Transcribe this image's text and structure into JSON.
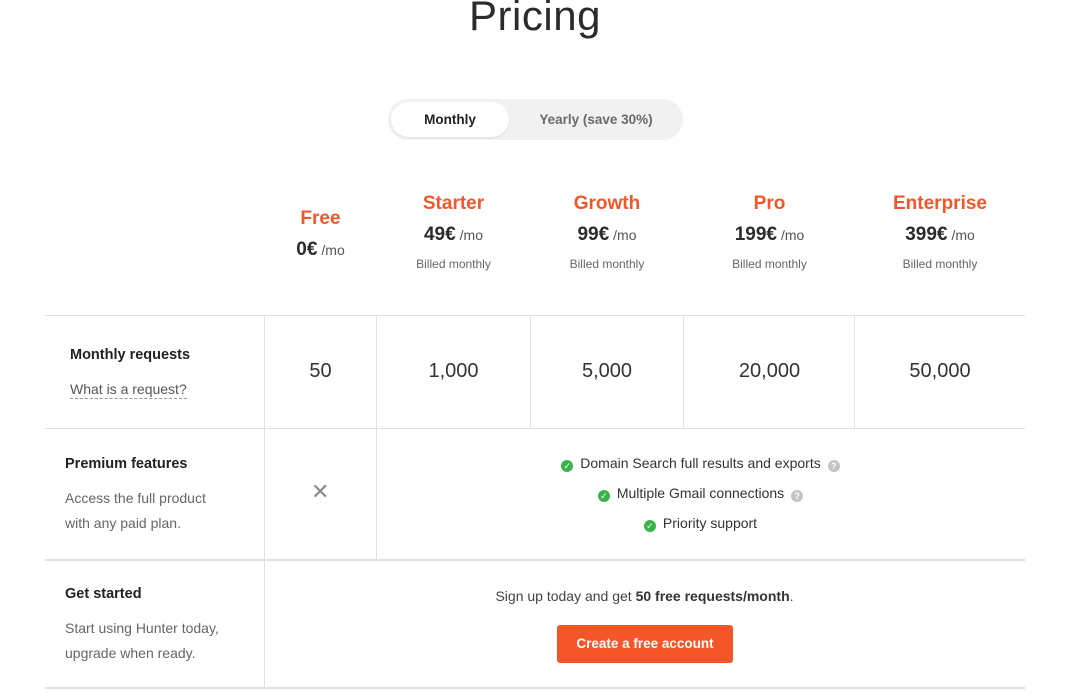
{
  "page": {
    "title": "Pricing"
  },
  "billing_toggle": {
    "monthly_label": "Monthly",
    "yearly_label": "Yearly (save 30%)",
    "selected": "Monthly"
  },
  "plans": [
    {
      "name": "Free",
      "price": "0€",
      "per": "/mo",
      "billed": ""
    },
    {
      "name": "Starter",
      "price": "49€",
      "per": "/mo",
      "billed": "Billed monthly"
    },
    {
      "name": "Growth",
      "price": "99€",
      "per": "/mo",
      "billed": "Billed monthly"
    },
    {
      "name": "Pro",
      "price": "199€",
      "per": "/mo",
      "billed": "Billed monthly"
    },
    {
      "name": "Enterprise",
      "price": "399€",
      "per": "/mo",
      "billed": "Billed monthly"
    }
  ],
  "rows": {
    "requests": {
      "title": "Monthly requests",
      "link": "What is a request?",
      "values": [
        "50",
        "1,000",
        "5,000",
        "20,000",
        "50,000"
      ]
    },
    "premium": {
      "title": "Premium features",
      "desc_line1": "Access the full product",
      "desc_line2": "with any paid plan.",
      "features": [
        "Domain Search full results and exports",
        "Multiple Gmail connections",
        "Priority support"
      ]
    },
    "get_started": {
      "title": "Get started",
      "desc_line1": "Start using Hunter today,",
      "desc_line2": "upgrade when ready.",
      "signup_prefix": "Sign up today and get",
      "signup_bold": "50 free requests/month",
      "signup_suffix": ".",
      "cta_label": "Create a free account"
    }
  },
  "icons": {
    "check": "check-circle-icon",
    "help": "question-circle-icon",
    "unavailable": "x-icon"
  },
  "colors": {
    "accent": "#f4562a",
    "check": "#3bb34a"
  }
}
